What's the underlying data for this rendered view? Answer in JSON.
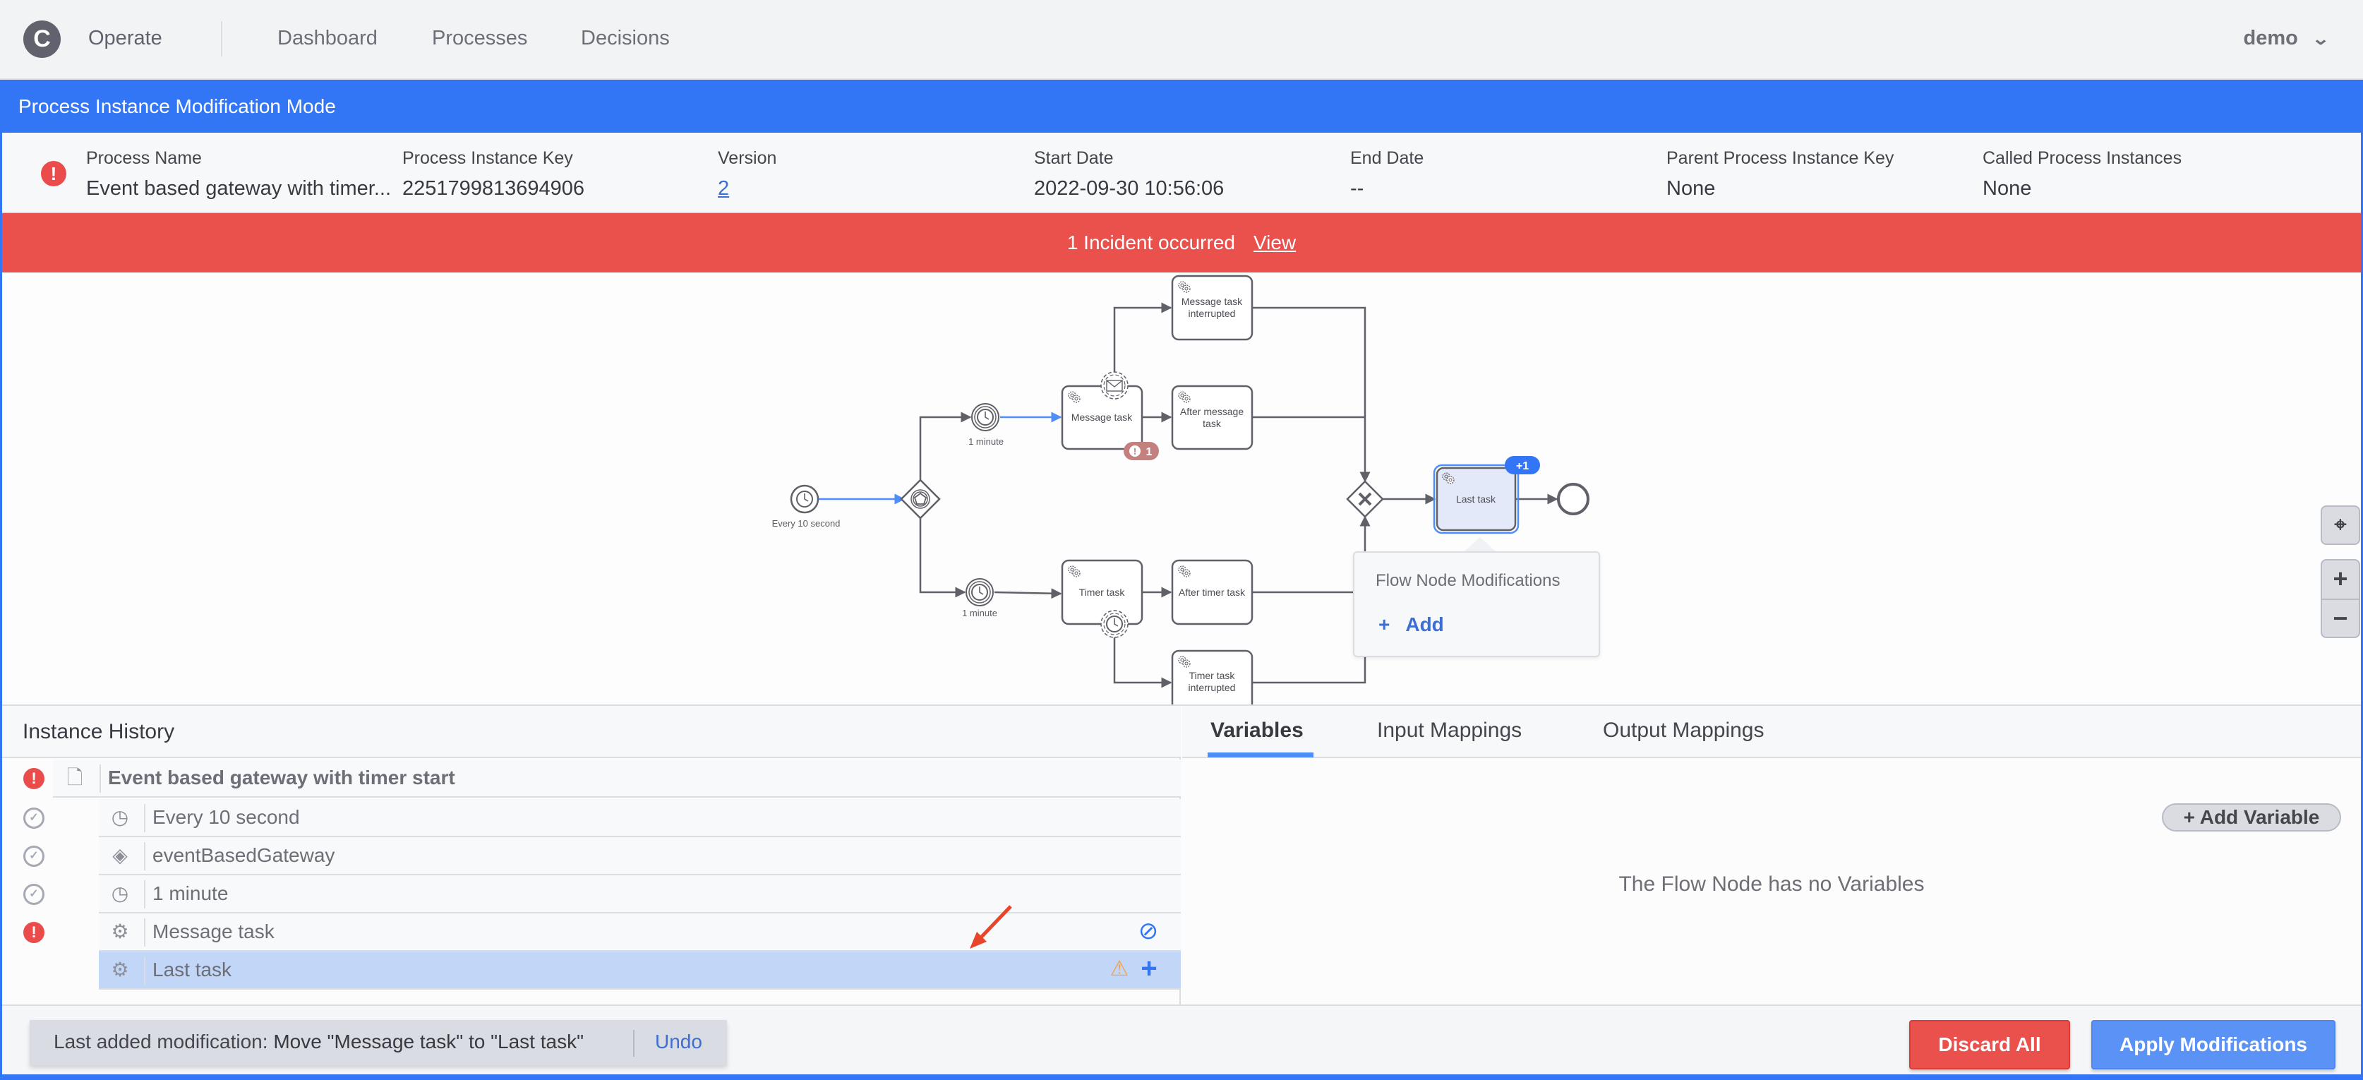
{
  "app": {
    "logo_letter": "C",
    "name": "Operate",
    "nav": [
      "Dashboard",
      "Processes",
      "Decisions"
    ],
    "user": "demo",
    "user_chevron": "chevron-down-icon"
  },
  "banner": {
    "title": "Process Instance Modification Mode"
  },
  "instance": {
    "state_icon": "incident-icon",
    "fields": [
      {
        "label": "Process Name",
        "value": "Event based gateway with timer..."
      },
      {
        "label": "Process Instance Key",
        "value": "2251799813694906"
      },
      {
        "label": "Version",
        "value": "2"
      },
      {
        "label": "Start Date",
        "value": "2022-09-30 10:56:06"
      },
      {
        "label": "End Date",
        "value": "--"
      },
      {
        "label": "Parent Process Instance Key",
        "value": "None"
      },
      {
        "label": "Called Process Instances",
        "value": "None"
      }
    ]
  },
  "incident_bar": {
    "text": "1 Incident occurred",
    "link": "View"
  },
  "diagram": {
    "nodes": {
      "start": "Every 10 second",
      "timer_upper": "1 minute",
      "timer_lower": "1 minute",
      "message_task": "Message task",
      "message_task_interrupted_1": "Message task",
      "message_task_interrupted_2": "interrupted",
      "after_message_1": "After message",
      "after_message_2": "task",
      "timer_task": "Timer task",
      "after_timer_task": "After timer task",
      "timer_task_interrupted_1": "Timer task",
      "timer_task_interrupted_2": "interrupted",
      "last_task": "Last task"
    },
    "incident_badge": "1",
    "modification_badge": "+1",
    "colors": {
      "active_flow": "#4f8ef7",
      "flow": "#5f6068",
      "incident_badge": "#c47f7f",
      "modification_badge": "#3276f6",
      "selected_fill": "#e3e9f9"
    }
  },
  "popover": {
    "title": "Flow Node Modifications",
    "add_label": "Add"
  },
  "zoom_controls": {
    "reset": "crosshair-icon",
    "zoom_in": "+",
    "zoom_out": "−"
  },
  "history": {
    "title": "Instance History",
    "rows": [
      {
        "status": "incident",
        "icon": "document-icon",
        "label": "Event based gateway with timer start"
      },
      {
        "status": "completed",
        "icon": "timer-icon",
        "label": "Every 10 second"
      },
      {
        "status": "completed",
        "icon": "event-gateway-icon",
        "label": "eventBasedGateway"
      },
      {
        "status": "completed",
        "icon": "intermediate-timer-icon",
        "label": "1 minute"
      },
      {
        "status": "incident",
        "icon": "service-task-icon",
        "label": "Message task",
        "action": "cancel-icon"
      },
      {
        "status": "none",
        "icon": "service-task-icon",
        "label": "Last task",
        "selected": true,
        "warning": "warning-icon",
        "action": "add-icon"
      }
    ]
  },
  "variables": {
    "tabs": [
      "Variables",
      "Input Mappings",
      "Output Mappings"
    ],
    "active_tab": "Variables",
    "add_button": "Add Variable",
    "empty_message": "The Flow Node has no Variables"
  },
  "footer": {
    "last_mod_prefix": "Last added modification:",
    "last_mod_text": "Move \"Message task\" to \"Last task\"",
    "undo": "Undo",
    "discard": "Discard All",
    "apply": "Apply Modifications"
  }
}
